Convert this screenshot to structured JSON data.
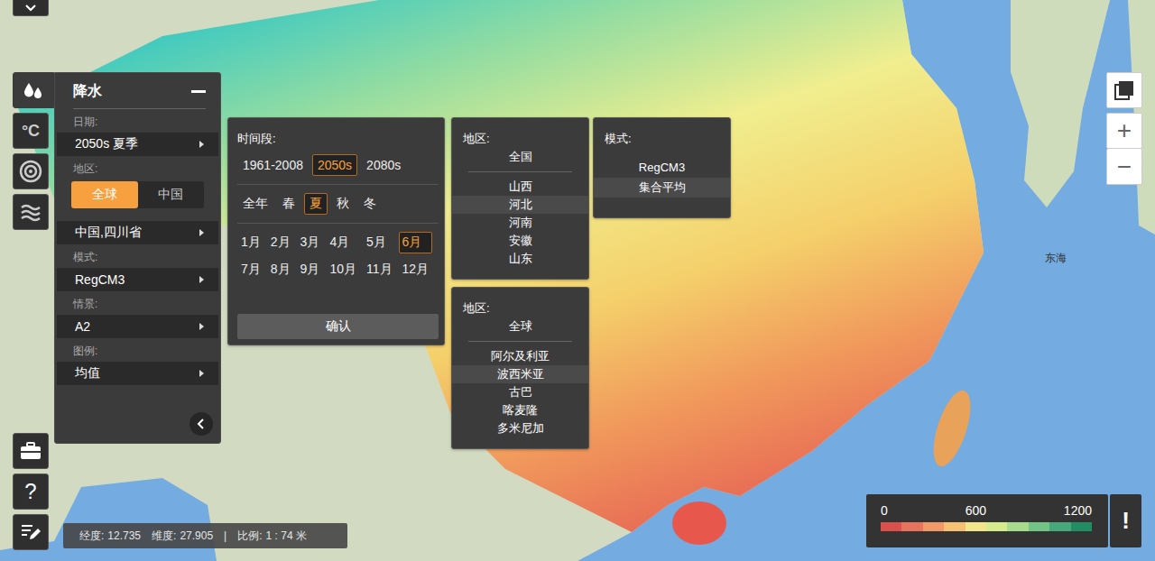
{
  "layer_tools": [
    {
      "kind": "drop",
      "selected": true
    },
    {
      "kind": "label",
      "label": "°C",
      "selected": false
    },
    {
      "kind": "target",
      "selected": false
    },
    {
      "kind": "wind",
      "selected": false
    }
  ],
  "bottom_tools": [
    {
      "kind": "toolbox"
    },
    {
      "kind": "label",
      "label": "?"
    },
    {
      "kind": "edit"
    }
  ],
  "panel": {
    "title": "降水",
    "rows": [
      {
        "kind": "label",
        "text": "日期:"
      },
      {
        "kind": "select",
        "text": "2050s 夏季"
      },
      {
        "kind": "label",
        "text": "地区:"
      },
      {
        "kind": "toggle",
        "options": [
          {
            "label": "全球",
            "selected": true
          },
          {
            "label": "中国",
            "selected": false
          }
        ]
      },
      {
        "kind": "select",
        "text": "中国,四川省"
      },
      {
        "kind": "label",
        "text": "模式:"
      },
      {
        "kind": "select",
        "text": "RegCM3"
      },
      {
        "kind": "label",
        "text": "情景:"
      },
      {
        "kind": "select",
        "text": "A2"
      },
      {
        "kind": "label",
        "text": "图例:"
      },
      {
        "kind": "select",
        "text": "均值"
      }
    ]
  },
  "time_popup": {
    "title": "时间段:",
    "periods": [
      {
        "label": "1961-2008",
        "selected": false
      },
      {
        "label": "2050s",
        "selected": true
      },
      {
        "label": "2080s",
        "selected": false
      }
    ],
    "seasons": [
      {
        "label": "全年",
        "selected": false
      },
      {
        "label": "春",
        "selected": false
      },
      {
        "label": "夏",
        "selected": true
      },
      {
        "label": "秋",
        "selected": false
      },
      {
        "label": "冬",
        "selected": false
      }
    ],
    "months": [
      {
        "label": "1月",
        "selected": false
      },
      {
        "label": "2月",
        "selected": false
      },
      {
        "label": "3月",
        "selected": false
      },
      {
        "label": "4月",
        "selected": false
      },
      {
        "label": "5月",
        "selected": false
      },
      {
        "label": "6月",
        "selected": true
      },
      {
        "label": "7月",
        "selected": false
      },
      {
        "label": "8月",
        "selected": false
      },
      {
        "label": "9月",
        "selected": false
      },
      {
        "label": "10月",
        "selected": false
      },
      {
        "label": "11月",
        "selected": false
      },
      {
        "label": "12月",
        "selected": false
      }
    ],
    "confirm": "确认"
  },
  "region_popups": [
    {
      "title": "地区:",
      "scope": "全国",
      "items": [
        {
          "label": "山西",
          "selected": false
        },
        {
          "label": "河北",
          "selected": true
        },
        {
          "label": "河南",
          "selected": false
        },
        {
          "label": "安徽",
          "selected": false
        },
        {
          "label": "山东",
          "selected": false
        }
      ]
    },
    {
      "title": "地区:",
      "scope": "全球",
      "items": [
        {
          "label": "阿尔及利亚",
          "selected": false
        },
        {
          "label": "波西米亚",
          "selected": true
        },
        {
          "label": "古巴",
          "selected": false
        },
        {
          "label": "喀麦隆",
          "selected": false
        },
        {
          "label": "多米尼加",
          "selected": false
        }
      ]
    }
  ],
  "model_popup": {
    "title": "模式:",
    "items": [
      {
        "label": "RegCM3",
        "selected": false
      },
      {
        "label": "集合平均",
        "selected": true
      }
    ]
  },
  "map_controls": {
    "zoom_in": "+",
    "zoom_out": "−"
  },
  "map_labels": [
    {
      "text": "东海"
    }
  ],
  "legend": {
    "ticks": [
      "0",
      "600",
      "1200"
    ],
    "colors": [
      "#d9504c",
      "#e8735c",
      "#f19a68",
      "#f5c071",
      "#f3e68a",
      "#d6eb8d",
      "#a8dc8c",
      "#74c487",
      "#46a87a",
      "#228c63"
    ],
    "info": "!"
  },
  "status_bar": {
    "lon_label": "经度:",
    "lon": "12.735",
    "lat_label": "维度:",
    "lat": "27.905",
    "separator": "|",
    "scale_label": "比例:",
    "scale": "1 : 74 米"
  }
}
